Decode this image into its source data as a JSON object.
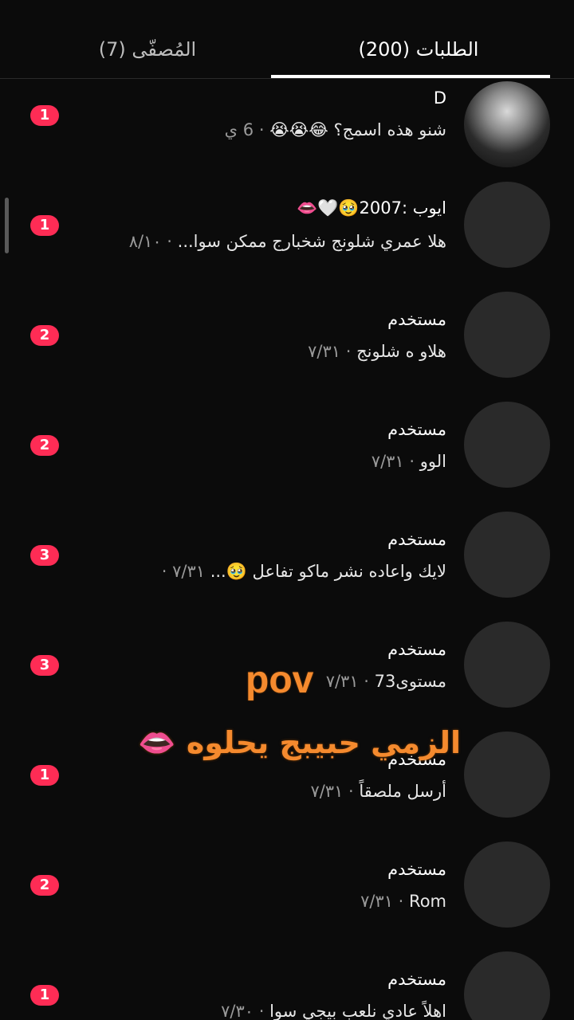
{
  "tabs": {
    "requests_label": "الطلبات (200)",
    "filtered_label": "المُصفّى (7)"
  },
  "conversations": [
    {
      "name": "D",
      "message": "شنو هذه اسمج؟ 😂😭😭",
      "time": "· 6 ي",
      "unread": "1"
    },
    {
      "name": "ايوب :2007🥹🤍👄",
      "message": "هلا عمري شلونج شخبارج ممكن سوا...",
      "time": "· ٨/١٠",
      "unread": "1"
    },
    {
      "name": "مستخدم",
      "message": "هلاو ه شلونج",
      "time": "· ٧/٣١",
      "unread": "2"
    },
    {
      "name": "مستخدم",
      "message": "الوو",
      "time": "· ٧/٣١",
      "unread": "2"
    },
    {
      "name": "مستخدم",
      "message": "لايك واعاده نشر ماكو تفاعل 🥹...",
      "time": "٧/٣١ ·",
      "unread": "3"
    },
    {
      "name": "مستخدم",
      "message": "مستوى73",
      "time": "· ٧/٣١",
      "unread": "3"
    },
    {
      "name": "مستخدم",
      "message": "أرسل ملصقاً",
      "time": "· ٧/٣١",
      "unread": "1"
    },
    {
      "name": "مستخدم",
      "message": "Rom",
      "time": "· ٧/٣١",
      "unread": "2"
    },
    {
      "name": "مستخدم",
      "message": "اهلاً عادي نلعب بيجي سوا",
      "time": "· ٧/٣٠",
      "unread": "1"
    }
  ],
  "overlay": {
    "pov": "pov",
    "caption": "الزمي حبيبج يحلوه 👄"
  }
}
